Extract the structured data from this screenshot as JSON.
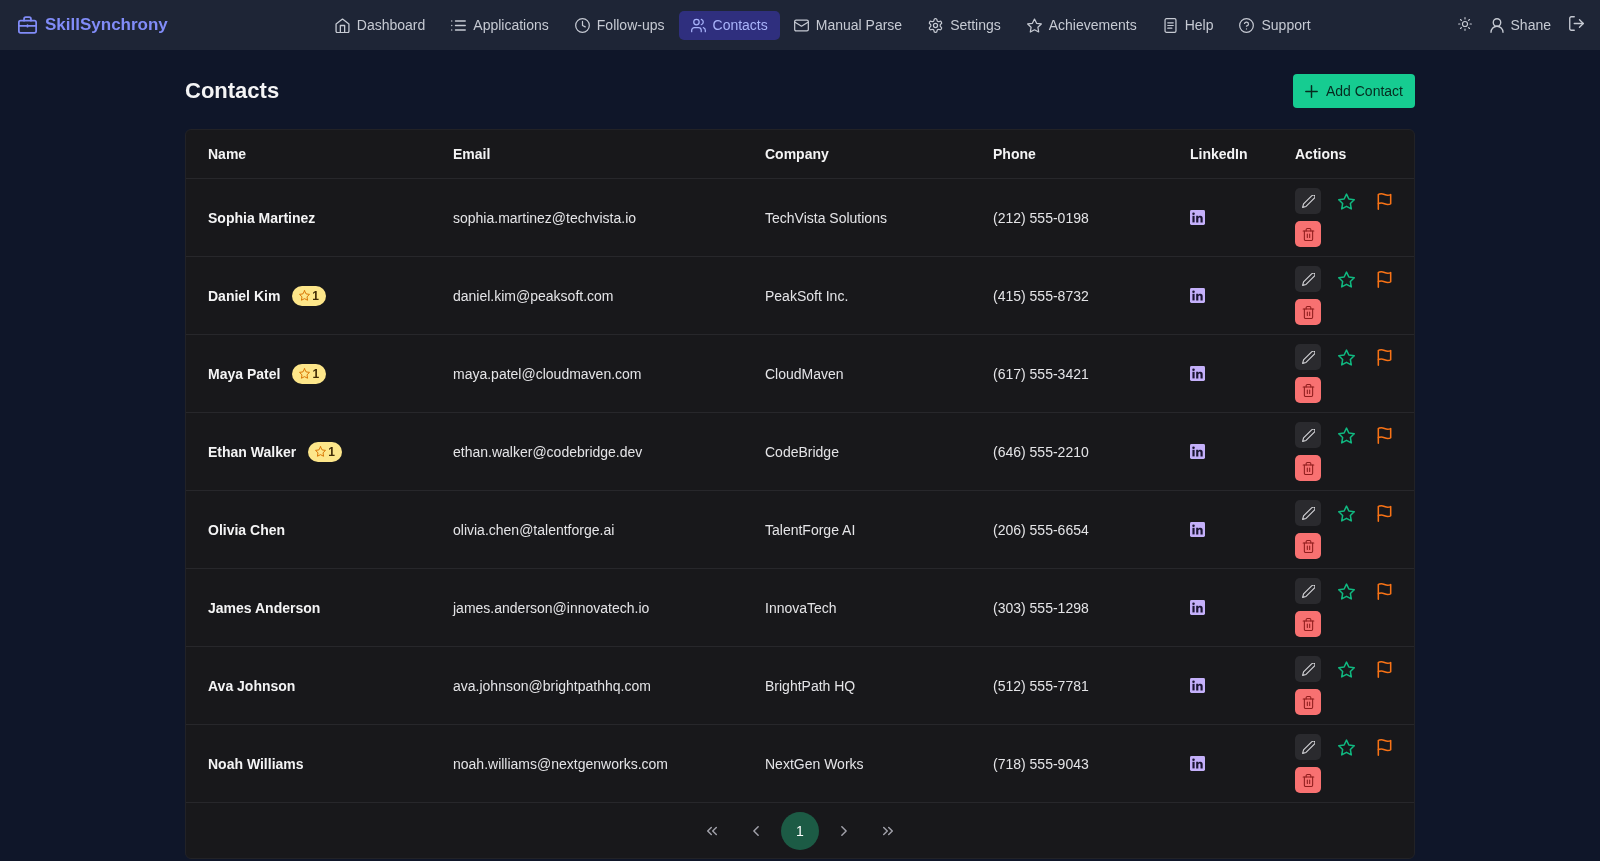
{
  "app": {
    "logo": "SkillSynchrony"
  },
  "nav": {
    "items": [
      {
        "label": "Dashboard",
        "selected": false
      },
      {
        "label": "Applications",
        "selected": false
      },
      {
        "label": "Follow-ups",
        "selected": false
      },
      {
        "label": "Contacts",
        "selected": true
      },
      {
        "label": "Manual Parse",
        "selected": false
      },
      {
        "label": "Settings",
        "selected": false
      },
      {
        "label": "Achievements",
        "selected": false
      },
      {
        "label": "Help",
        "selected": false
      },
      {
        "label": "Support",
        "selected": false
      }
    ]
  },
  "user": {
    "name": "Shane"
  },
  "page": {
    "title": "Contacts",
    "add_button": "Add Contact"
  },
  "table": {
    "columns": [
      "Name",
      "Email",
      "Company",
      "Phone",
      "LinkedIn",
      "Actions"
    ],
    "rows": [
      {
        "name": "Sophia Martinez",
        "email": "sophia.martinez@techvista.io",
        "company": "TechVista Solutions",
        "phone": "(212) 555-0198",
        "has_linkedin": true
      },
      {
        "name": "Daniel Kim",
        "badge": "1",
        "email": "daniel.kim@peaksoft.com",
        "company": "PeakSoft Inc.",
        "phone": "(415) 555-8732",
        "has_linkedin": true
      },
      {
        "name": "Maya Patel",
        "badge": "1",
        "email": "maya.patel@cloudmaven.com",
        "company": "CloudMaven",
        "phone": "(617) 555-3421",
        "has_linkedin": true
      },
      {
        "name": "Ethan Walker",
        "badge": "1",
        "email": "ethan.walker@codebridge.dev",
        "company": "CodeBridge",
        "phone": "(646) 555-2210",
        "has_linkedin": true
      },
      {
        "name": "Olivia Chen",
        "email": "olivia.chen@talentforge.ai",
        "company": "TalentForge AI",
        "phone": "(206) 555-6654",
        "has_linkedin": true
      },
      {
        "name": "James Anderson",
        "email": "james.anderson@innovatech.io",
        "company": "InnovaTech",
        "phone": "(303) 555-1298",
        "has_linkedin": true
      },
      {
        "name": "Ava Johnson",
        "email": "ava.johnson@brightpathhq.com",
        "company": "BrightPath HQ",
        "phone": "(512) 555-7781",
        "has_linkedin": true
      },
      {
        "name": "Noah Williams",
        "email": "noah.williams@nextgenworks.com",
        "company": "NextGen Works",
        "phone": "(718) 555-9043",
        "has_linkedin": true
      }
    ]
  },
  "pagination": {
    "pages": [
      {
        "label": "1",
        "selected": true
      }
    ]
  }
}
